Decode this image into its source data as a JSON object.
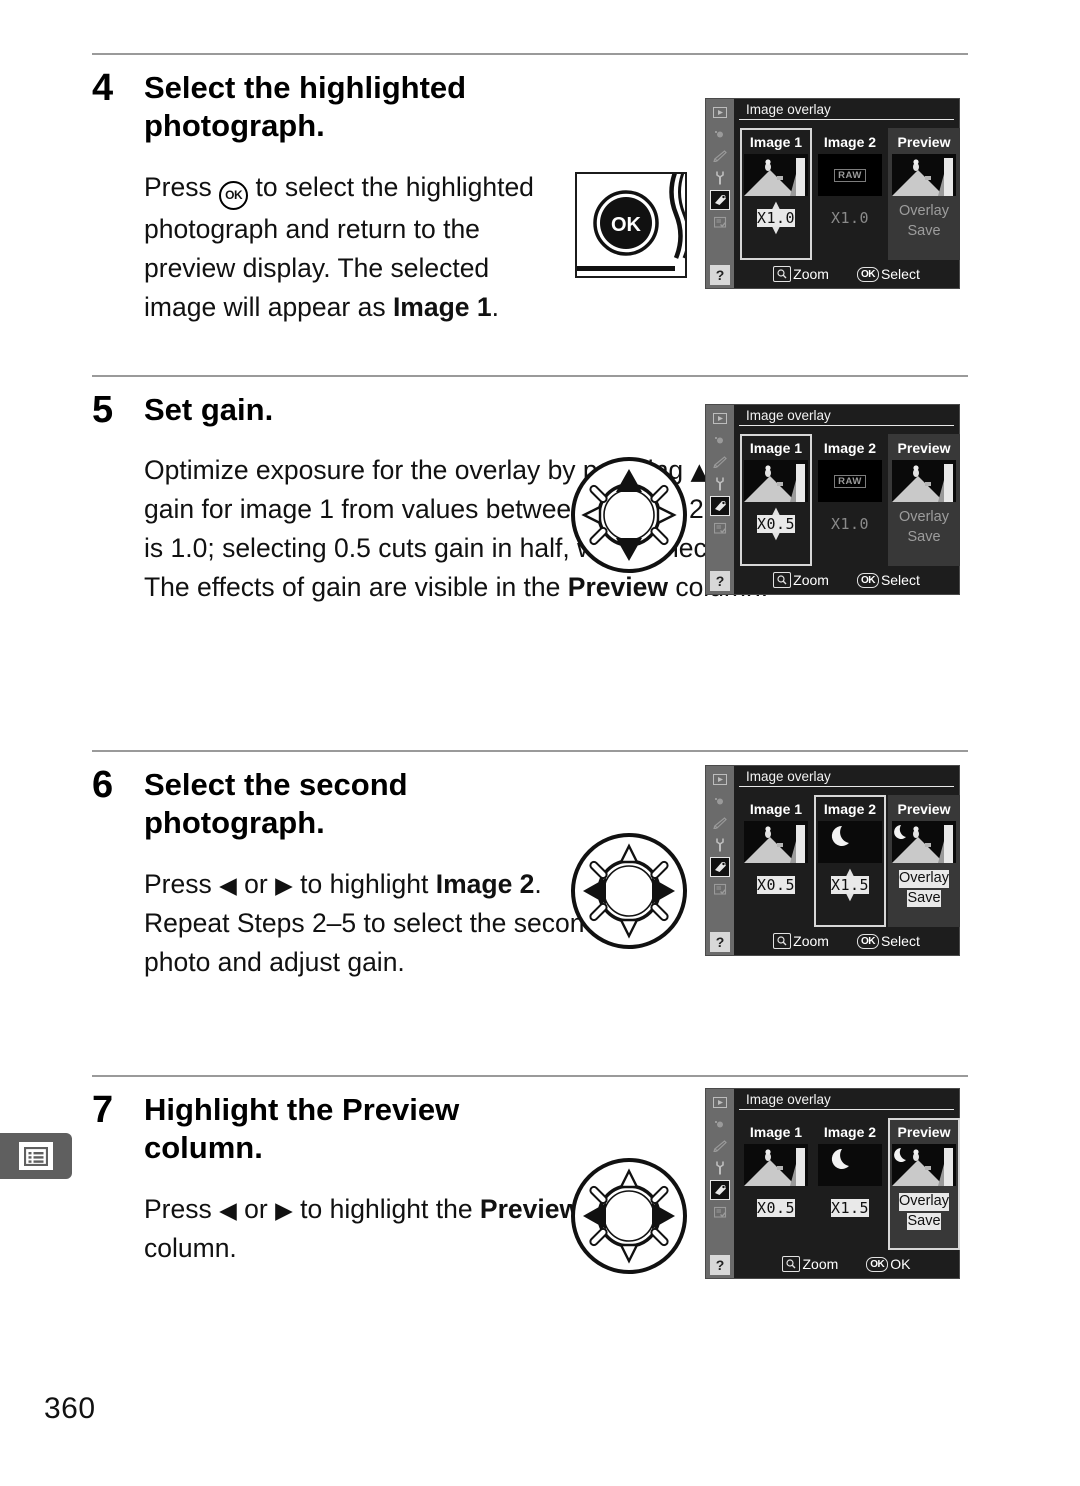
{
  "page": {
    "number": "360",
    "margin_tab_icon": "menu-list-icon"
  },
  "steps": [
    {
      "number": "4",
      "title": "Select the highlighted photograph.",
      "body_html": "Press <span class=\"ok-inline\">OK</span> to select the highlighted photograph and return to the preview display. The selected image will appear as <b>Image 1</b>.",
      "body_plain": "Press OK to select the highlighted photograph and return to the preview display. The selected image will appear as Image 1.",
      "art": "ok-button-photo"
    },
    {
      "number": "5",
      "title": "Set gain.",
      "body_html": "Optimize exposure for the overlay by pressing <span class=\"tri\">&#9650;</span> or <span class=\"tri\">&#9660;</span> to select the gain for image 1 from values between 0.1 and 2.0.  The default value is 1.0; selecting 0.5 cuts gain in half, while selecting 2.0 doubles gain. The effects of gain are visible in the <b>Preview</b> column.",
      "body_plain": "Optimize exposure for the overlay by pressing up or down to select the gain for image 1 from values between 0.1 and 2.0. The default value is 1.0; selecting 0.5 cuts gain in half, while selecting 2.0 doubles gain. The effects of gain are visible in the Preview column.",
      "art": "multi-selector-updown"
    },
    {
      "number": "6",
      "title": "Select the second photograph.",
      "body_html": "Press <span class=\"tri\">&#9664;</span> or <span class=\"tri\">&#9654;</span> to highlight <b>Image 2</b>.  Repeat Steps 2&ndash;5 to select the second photo and adjust gain.",
      "body_plain": "Press left or right to highlight Image 2. Repeat Steps 2-5 to select the second photo and adjust gain.",
      "art": "multi-selector-leftright"
    },
    {
      "number": "7",
      "title_html": "Highlight the <b>Preview</b> column.",
      "title": "Highlight the Preview column.",
      "body_html": "Press <span class=\"tri\">&#9664;</span> or <span class=\"tri\">&#9654;</span>  to highlight the <b>Preview</b> column.",
      "body_plain": "Press left or right to highlight the Preview column.",
      "art": "multi-selector-leftright"
    }
  ],
  "lcd_screens": [
    {
      "id": "screen-step4",
      "title": "Image overlay",
      "sidebar_icons": [
        "playback-icon",
        "shooting-menu-icon",
        "custom-settings-icon",
        "setup-icon",
        "retouch-icon",
        "recent-settings-icon"
      ],
      "sidebar_active_index": 4,
      "help_label": "?",
      "columns": [
        {
          "label": "Image 1",
          "thumb": "person-hill-photo",
          "gain": "X1.0",
          "gain_state": "highlighted",
          "selected": true,
          "arrows": true
        },
        {
          "label": "Image 2",
          "thumb": "raw-placeholder",
          "thumb_badge": "RAW",
          "gain": "X1.0",
          "gain_state": "dim",
          "selected": false,
          "arrows": false
        },
        {
          "label": "Preview",
          "thumb": "person-hill-photo",
          "preview": true,
          "actions": [
            "Overlay",
            "Save"
          ],
          "actions_state": "dim",
          "selected": false
        }
      ],
      "footer": [
        {
          "icon": "zoom-icon",
          "label": "Zoom"
        },
        {
          "icon": "ok-icon",
          "label": "Select"
        }
      ]
    },
    {
      "id": "screen-step5",
      "title": "Image overlay",
      "sidebar_icons": [
        "playback-icon",
        "shooting-menu-icon",
        "custom-settings-icon",
        "setup-icon",
        "retouch-icon",
        "recent-settings-icon"
      ],
      "sidebar_active_index": 4,
      "help_label": "?",
      "columns": [
        {
          "label": "Image 1",
          "thumb": "person-hill-photo",
          "gain": "X0.5",
          "gain_state": "highlighted",
          "selected": true,
          "arrows": true
        },
        {
          "label": "Image 2",
          "thumb": "raw-placeholder",
          "thumb_badge": "RAW",
          "gain": "X1.0",
          "gain_state": "dim",
          "selected": false,
          "arrows": false
        },
        {
          "label": "Preview",
          "thumb": "person-hill-photo",
          "preview": true,
          "actions": [
            "Overlay",
            "Save"
          ],
          "actions_state": "dim",
          "selected": false
        }
      ],
      "footer": [
        {
          "icon": "zoom-icon",
          "label": "Zoom"
        },
        {
          "icon": "ok-icon",
          "label": "Select"
        }
      ]
    },
    {
      "id": "screen-step6",
      "title": "Image overlay",
      "sidebar_icons": [
        "playback-icon",
        "shooting-menu-icon",
        "custom-settings-icon",
        "setup-icon",
        "retouch-icon",
        "recent-settings-icon"
      ],
      "sidebar_active_index": 4,
      "help_label": "?",
      "columns": [
        {
          "label": "Image 1",
          "thumb": "person-hill-photo",
          "gain": "X0.5",
          "gain_state": "highlighted",
          "selected": false,
          "arrows": false
        },
        {
          "label": "Image 2",
          "thumb": "moon-photo",
          "gain": "X1.5",
          "gain_state": "highlighted",
          "selected": true,
          "arrows": true
        },
        {
          "label": "Preview",
          "thumb": "moon-person-hill-photo",
          "preview": true,
          "actions": [
            "Overlay",
            "Save"
          ],
          "actions_state": "highlighted",
          "selected": false
        }
      ],
      "footer": [
        {
          "icon": "zoom-icon",
          "label": "Zoom"
        },
        {
          "icon": "ok-icon",
          "label": "Select"
        }
      ]
    },
    {
      "id": "screen-step7",
      "title": "Image overlay",
      "sidebar_icons": [
        "playback-icon",
        "shooting-menu-icon",
        "custom-settings-icon",
        "setup-icon",
        "retouch-icon",
        "recent-settings-icon"
      ],
      "sidebar_active_index": 4,
      "help_label": "?",
      "columns": [
        {
          "label": "Image 1",
          "thumb": "person-hill-photo",
          "gain": "X0.5",
          "gain_state": "highlighted",
          "selected": false,
          "arrows": false
        },
        {
          "label": "Image 2",
          "thumb": "moon-photo",
          "gain": "X1.5",
          "gain_state": "highlighted",
          "selected": false,
          "arrows": false
        },
        {
          "label": "Preview",
          "thumb": "moon-person-hill-photo",
          "preview": true,
          "actions": [
            "Overlay",
            "Save"
          ],
          "actions_state": "highlighted",
          "selected": true
        }
      ],
      "footer": [
        {
          "icon": "zoom-icon",
          "label": "Zoom"
        },
        {
          "icon": "ok-icon",
          "label": "OK"
        }
      ]
    }
  ],
  "ok_button": {
    "label": "OK"
  },
  "colors": {
    "rule": "#9a9a9a",
    "lcd_background": "#1d1d1d",
    "lcd_sidebar": "#6b6b6b",
    "highlight": "#e9e9e9",
    "dim_text": "#9a9a9a",
    "margin_tab": "#5f5f5f"
  }
}
